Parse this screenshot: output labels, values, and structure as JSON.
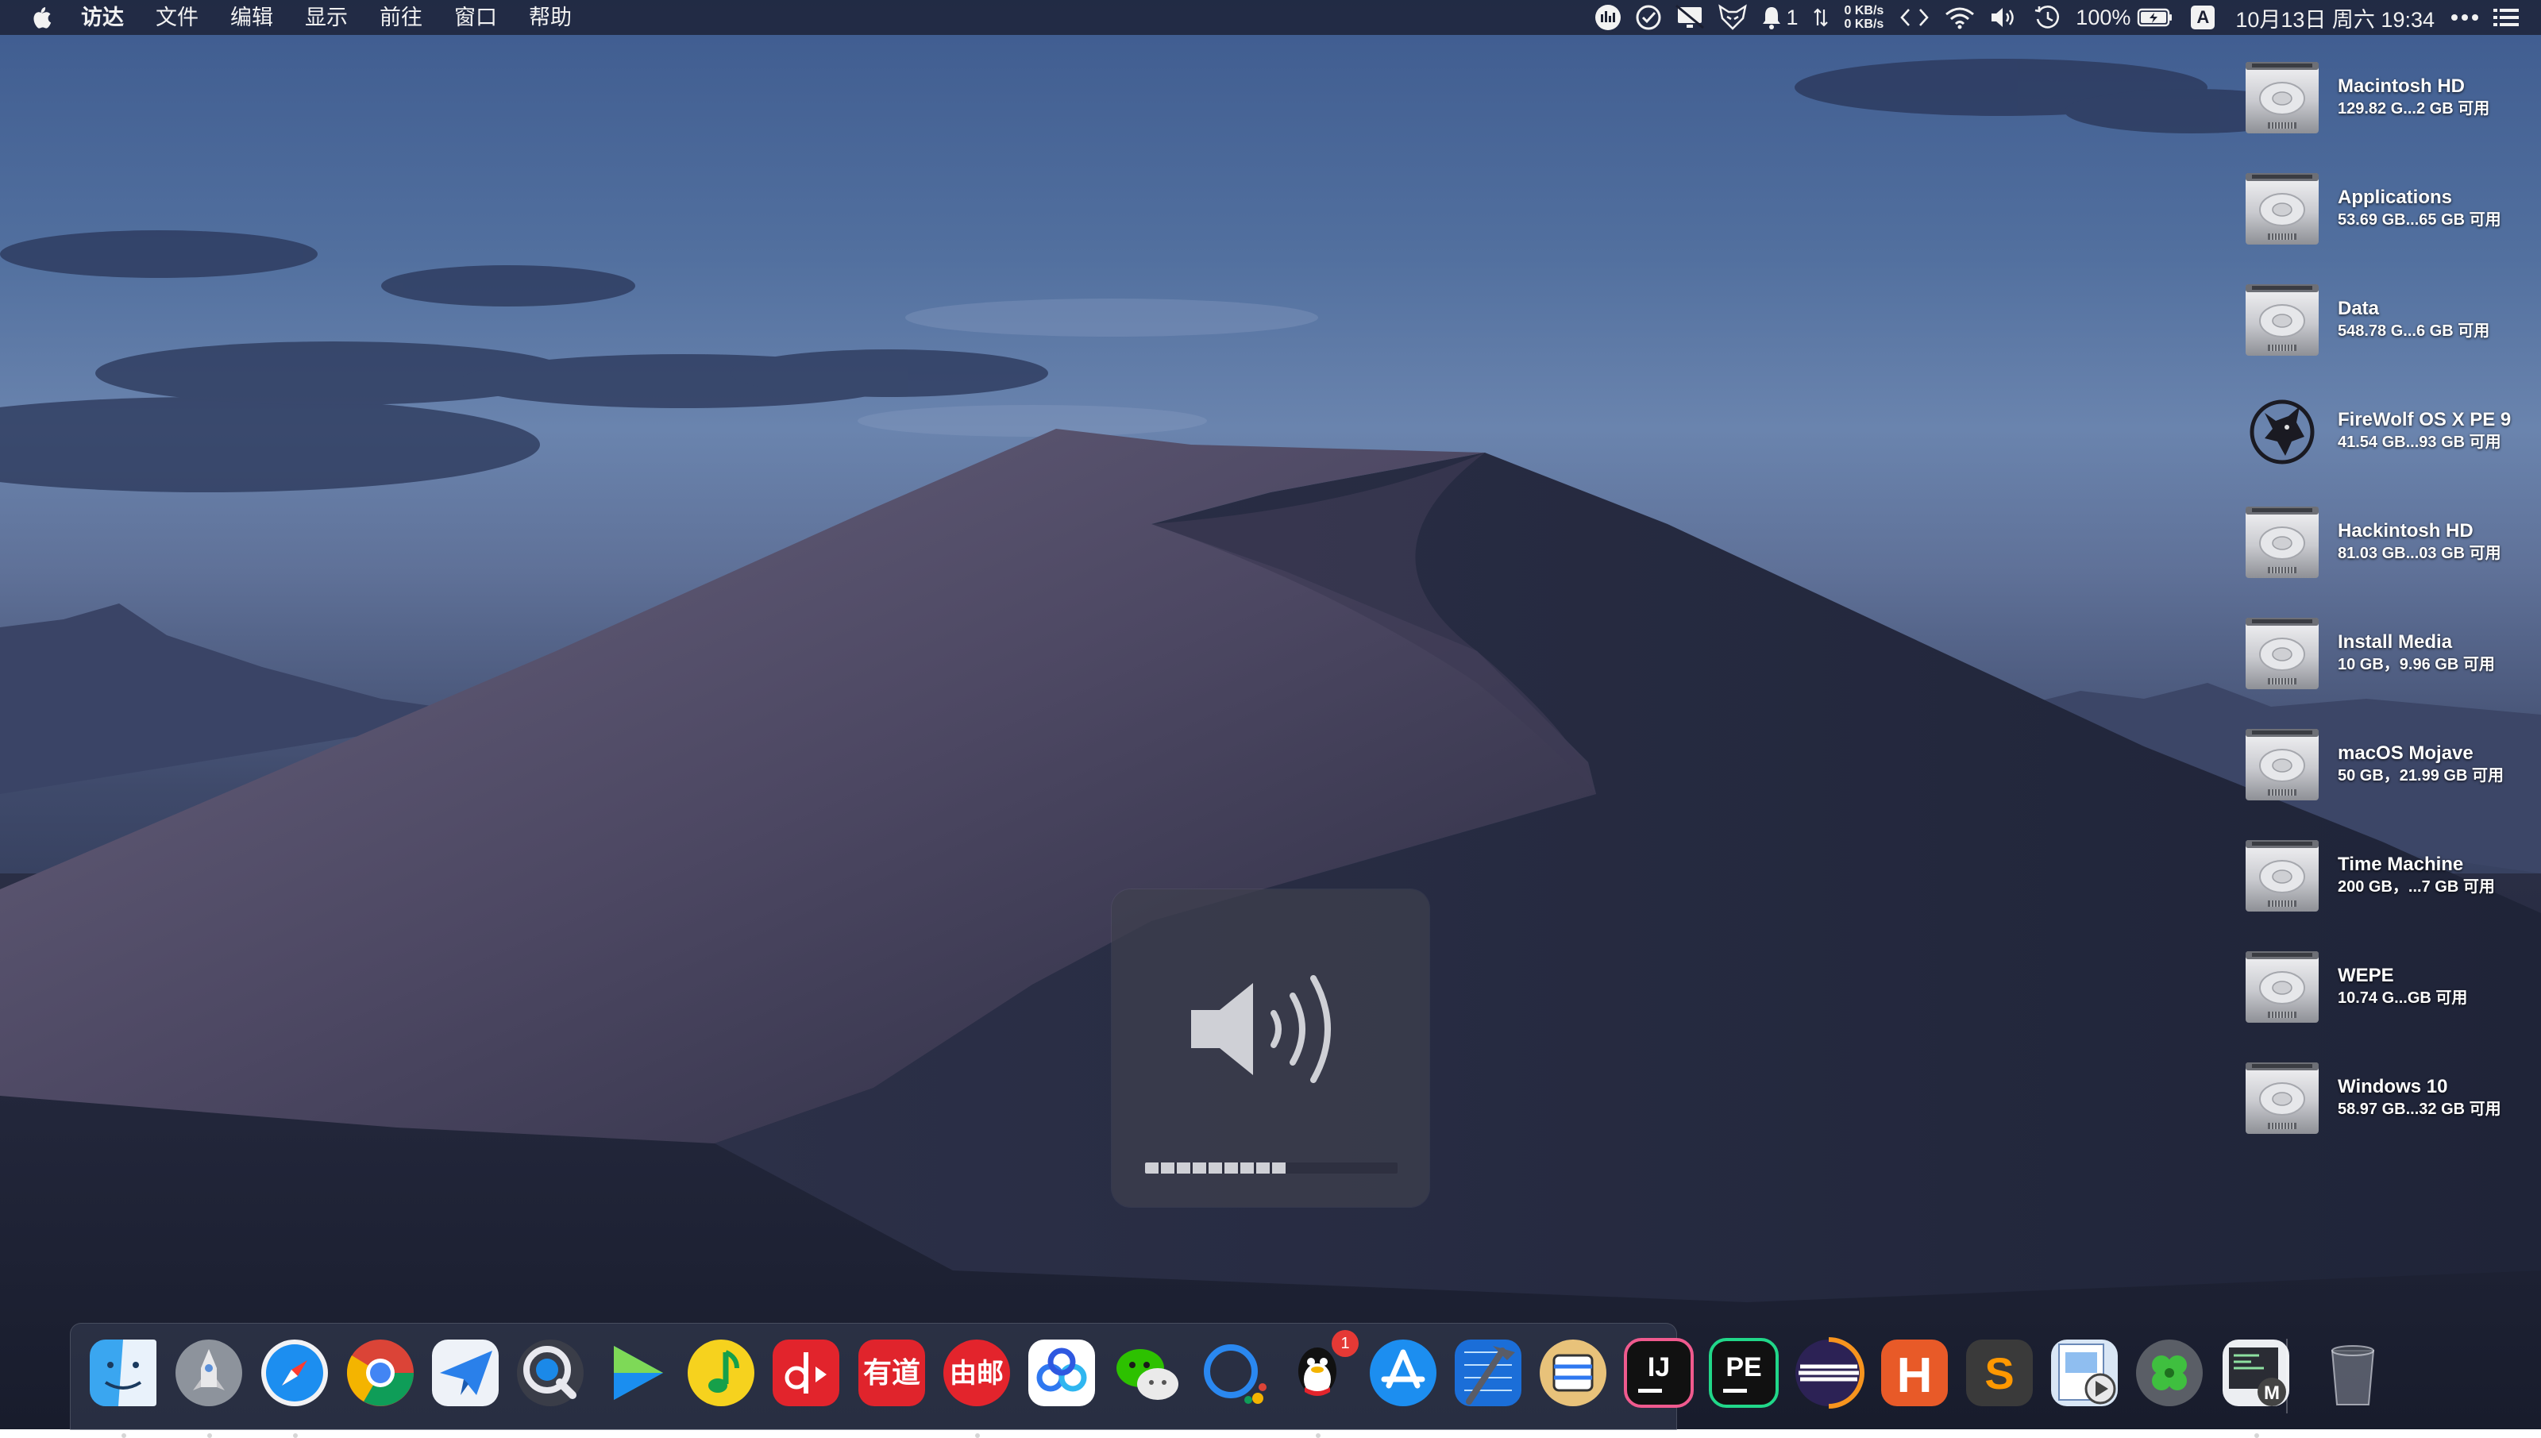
{
  "menubar": {
    "app_name": "访达",
    "items": [
      "文件",
      "编辑",
      "显示",
      "前往",
      "窗口",
      "帮助"
    ],
    "status": {
      "notification_count": "1",
      "net_up": "0 KB/s",
      "net_down": "0 KB/s",
      "battery": "100%",
      "input_method": "A",
      "clock": "10月13日 周六 19:34"
    },
    "icons": [
      "apple-icon",
      "istat-icon",
      "check-circle-icon",
      "display-icon",
      "fox-icon",
      "bell-icon",
      "arrows-icon",
      "code-brackets-icon",
      "wifi-icon",
      "volume-icon",
      "time-machine-icon",
      "battery-icon",
      "more-icon",
      "list-icon"
    ]
  },
  "drives": [
    {
      "name": "Macintosh HD",
      "info": "129.82 G...2 GB 可用",
      "icon": "hard-drive-icon"
    },
    {
      "name": "Applications",
      "info": "53.69 GB...65 GB 可用",
      "icon": "hard-drive-icon"
    },
    {
      "name": "Data",
      "info": "548.78 G...6 GB 可用",
      "icon": "hard-drive-icon"
    },
    {
      "name": "FireWolf OS X PE 9",
      "info": "41.54 GB...93 GB 可用",
      "icon": "wolf-icon"
    },
    {
      "name": "Hackintosh HD",
      "info": "81.03 GB...03 GB 可用",
      "icon": "hard-drive-icon"
    },
    {
      "name": "Install Media",
      "info": "10 GB，9.96 GB 可用",
      "icon": "hard-drive-icon"
    },
    {
      "name": "macOS Mojave",
      "info": "50 GB，21.99 GB 可用",
      "icon": "hard-drive-icon"
    },
    {
      "name": "Time Machine",
      "info": "200 GB，...7 GB 可用",
      "icon": "hard-drive-icon"
    },
    {
      "name": "WEPE",
      "info": "10.74 G...GB 可用",
      "icon": "hard-drive-icon"
    },
    {
      "name": "Windows 10",
      "info": "58.97 GB...32 GB 可用",
      "icon": "hard-drive-icon"
    }
  ],
  "volume_hud": {
    "level_segments": 9,
    "total_segments": 16,
    "level_fraction": 0.53
  },
  "dock": {
    "apps": [
      {
        "name": "finder",
        "running": true
      },
      {
        "name": "launchpad",
        "running": true
      },
      {
        "name": "safari",
        "running": true
      },
      {
        "name": "chrome",
        "running": false
      },
      {
        "name": "airmail",
        "running": false
      },
      {
        "name": "quicktime",
        "running": false
      },
      {
        "name": "infuse",
        "running": false
      },
      {
        "name": "qq-music",
        "running": false
      },
      {
        "name": "netease-music",
        "running": false
      },
      {
        "name": "youdao",
        "running": false,
        "label": "有道"
      },
      {
        "name": "netease-mail",
        "running": true,
        "label": "由邮"
      },
      {
        "name": "baidu-netdisk",
        "running": false
      },
      {
        "name": "wechat",
        "running": false
      },
      {
        "name": "dingtalk",
        "running": false
      },
      {
        "name": "qq",
        "running": true,
        "badge": "1"
      },
      {
        "name": "app-store",
        "running": false
      },
      {
        "name": "xcode",
        "running": false
      },
      {
        "name": "sequel-pro",
        "running": false
      },
      {
        "name": "intellij-idea",
        "running": false,
        "label": "IJ"
      },
      {
        "name": "pycharm",
        "running": false,
        "label": "PE"
      },
      {
        "name": "eclipse",
        "running": false
      },
      {
        "name": "hbuilder",
        "running": false,
        "label": "H"
      },
      {
        "name": "sublime-text",
        "running": false,
        "label": "S"
      },
      {
        "name": "preview",
        "running": false
      },
      {
        "name": "clover",
        "running": false
      },
      {
        "name": "macdown",
        "running": true,
        "label": "M"
      },
      {
        "name": "trash",
        "running": false
      }
    ]
  }
}
